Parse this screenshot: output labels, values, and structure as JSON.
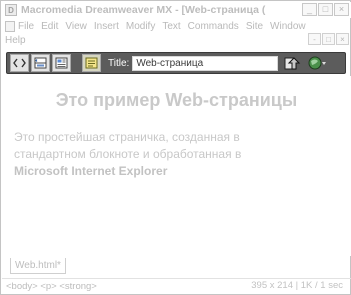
{
  "window": {
    "title": "Macromedia Dreamweaver MX - [Web-страница (",
    "app_icon": "dreamweaver-icon",
    "controls": [
      "_",
      "□",
      "×"
    ]
  },
  "menu": {
    "items": [
      "File",
      "Edit",
      "View",
      "Insert",
      "Modify",
      "Text",
      "Commands",
      "Site",
      "Window",
      "Help"
    ],
    "doc_controls": [
      "-",
      "□",
      "×"
    ]
  },
  "toolbar": {
    "buttons": [
      {
        "icon": "code-view-icon"
      },
      {
        "icon": "split-view-icon"
      },
      {
        "icon": "design-view-icon"
      },
      {
        "icon": "live-data-icon"
      }
    ],
    "title_label": "Title:",
    "title_value": "Web-страница",
    "right_icons": [
      "file-management-icon",
      "preview-in-browser-icon"
    ]
  },
  "document": {
    "heading": "Это пример Web-страницы",
    "paragraph_lines": [
      "Это простейшая страничка, созданная в",
      "стандартном блокноте и обработанная в"
    ],
    "paragraph_bold": "Microsoft Internet Explorer"
  },
  "tabs": {
    "active": "Web.html*"
  },
  "status": {
    "tag_selector": "<body> <p> <strong>",
    "size_info": "395 x 214",
    "download_info": "1K / 1 sec"
  }
}
